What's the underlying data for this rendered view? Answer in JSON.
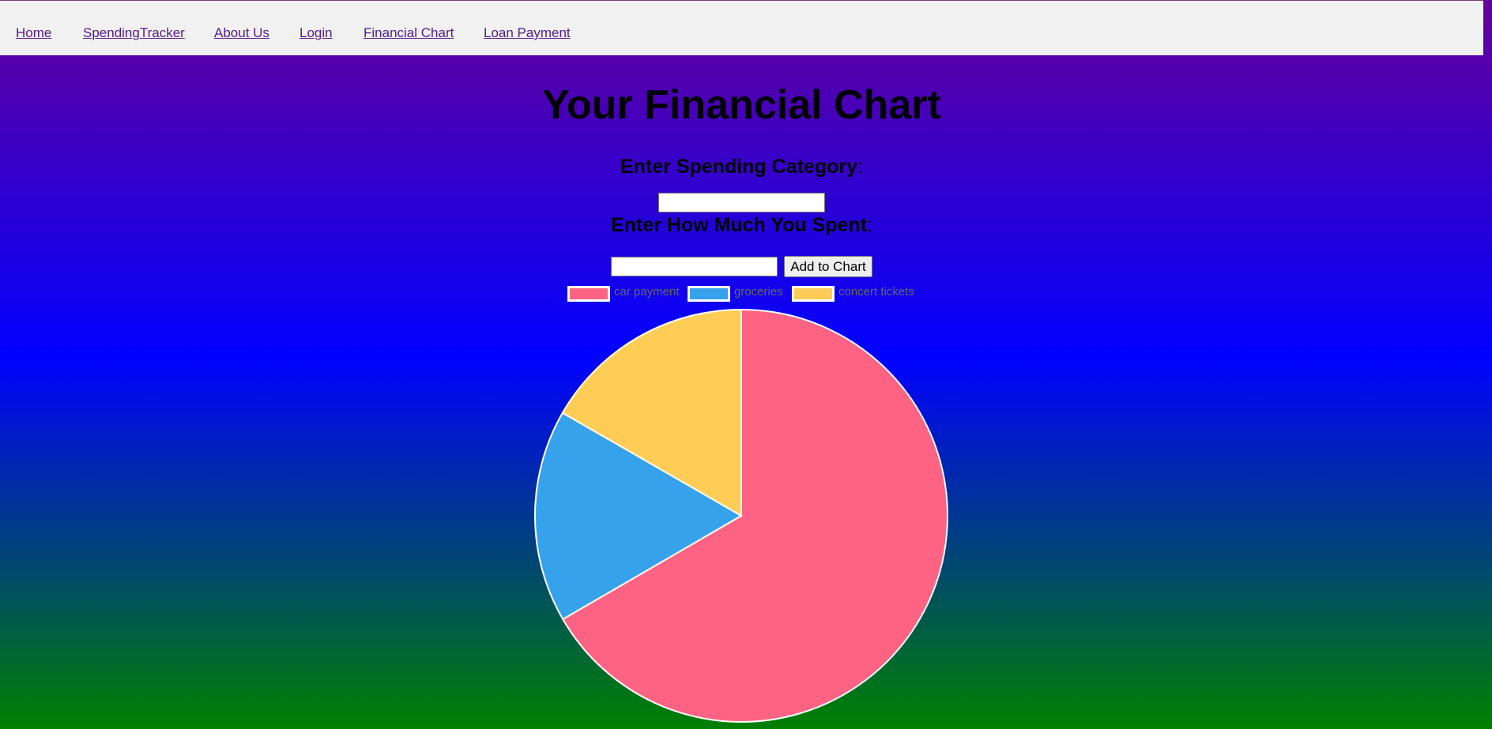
{
  "nav": {
    "items": [
      {
        "label": "Home"
      },
      {
        "label": "SpendingTracker"
      },
      {
        "label": "About Us"
      },
      {
        "label": "Login"
      },
      {
        "label": "Financial Chart"
      },
      {
        "label": "Loan Payment"
      }
    ]
  },
  "main": {
    "title": "Your Financial Chart",
    "category_label": "Enter Spending Category",
    "amount_label": "Enter How Much You Spent",
    "colon": ":",
    "category_input": {
      "value": "",
      "placeholder": ""
    },
    "amount_input": {
      "value": "",
      "placeholder": ""
    },
    "add_button_label": "Add to Chart"
  },
  "chart_data": {
    "type": "pie",
    "categories": [
      "car payment",
      "groceries",
      "concert tickets"
    ],
    "values": [
      66.7,
      16.7,
      16.7
    ],
    "colors": [
      "#ff6384",
      "#36a2eb",
      "#ffcd56"
    ],
    "legend_position": "top",
    "title": ""
  }
}
